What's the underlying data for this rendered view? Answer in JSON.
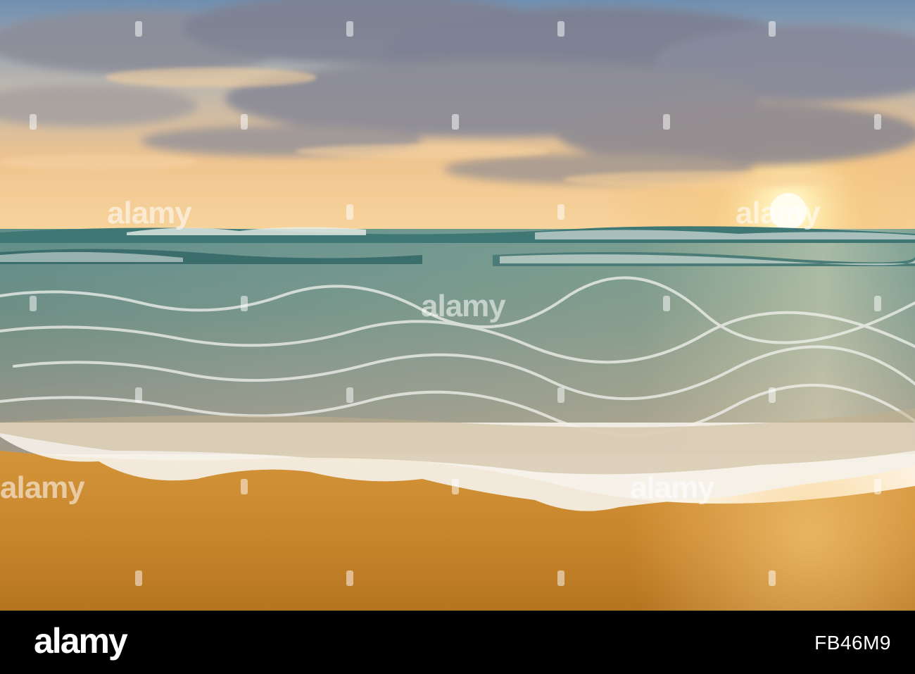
{
  "image": {
    "scene": "sunset over sea waves washing onto sandy beach",
    "palette": {
      "sky_top": "#7f9bb8",
      "sky_glow": "#f7c98a",
      "sun": "#fff4cf",
      "sea": "#4f7f7c",
      "foam": "#f4f1ea",
      "sand": "#c98a2f",
      "sand_dark": "#a66a1e"
    }
  },
  "watermark": {
    "text": "alamy"
  },
  "footer": {
    "logo": "alamy",
    "image_id": "FB46M9"
  }
}
